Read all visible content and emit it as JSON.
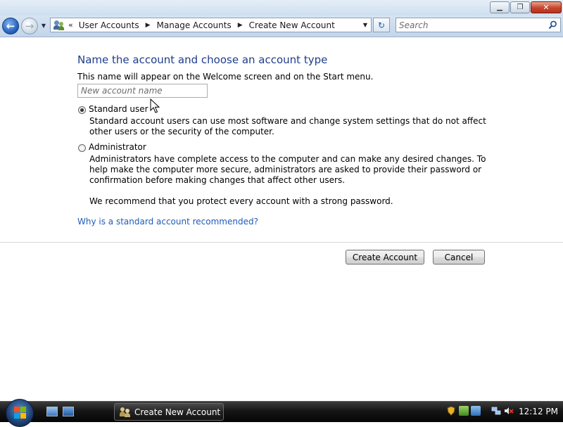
{
  "window": {
    "minimize_glyph": "▁",
    "maximize_glyph": "❐",
    "close_glyph": "✕"
  },
  "nav": {
    "back_glyph": "←",
    "forward_glyph": "→",
    "history_glyph": "▼",
    "breadcrumb_overflow": "«",
    "breadcrumbs": [
      "User Accounts",
      "Manage Accounts",
      "Create New Account"
    ],
    "breadcrumb_separator": "▶",
    "address_dropdown_glyph": "▼",
    "refresh_glyph": "↻",
    "search_placeholder": "Search"
  },
  "page": {
    "heading": "Name the account and choose an account type",
    "subtext": "This name will appear on the Welcome screen and on the Start menu.",
    "name_placeholder": "New account name",
    "name_value": "",
    "options": [
      {
        "label": "Standard user",
        "checked": true,
        "description": "Standard account users can use most software and change system settings that do not affect other users or the security of the computer."
      },
      {
        "label": "Administrator",
        "checked": false,
        "description": "Administrators have complete access to the computer and can make any desired changes. To help make the computer more secure, administrators are asked to provide their password or confirmation before making changes that affect other users."
      }
    ],
    "recommendation": "We recommend that you protect every account with a strong password.",
    "help_link": "Why is a standard account recommended?",
    "create_button": "Create Account",
    "cancel_button": "Cancel"
  },
  "taskbar": {
    "task_label": "Create New Account",
    "clock": "12:12 PM"
  },
  "colors": {
    "heading": "#1e3d8c",
    "link": "#1e5bb8"
  }
}
